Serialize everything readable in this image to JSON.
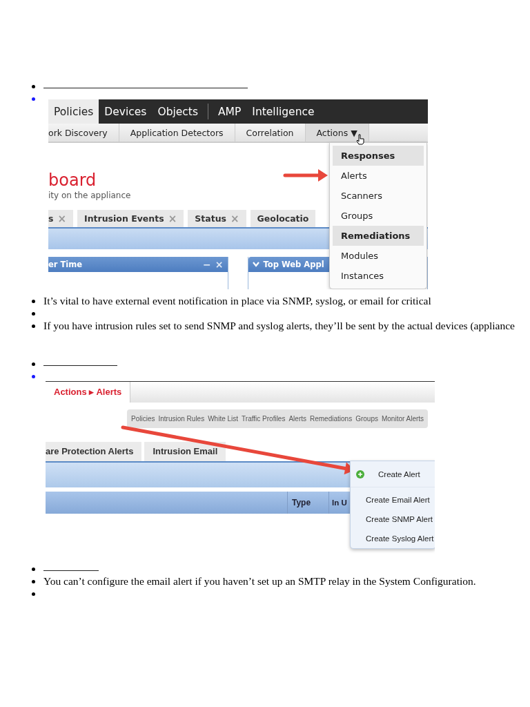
{
  "sections": [
    {
      "items": [
        {
          "kind": "long_rule"
        },
        {
          "kind": "nav_screenshot"
        },
        {
          "kind": "text",
          "text": "It’s vital to have external event notification in place via SNMP, syslog, or email for critical"
        },
        {
          "kind": "empty"
        },
        {
          "kind": "text",
          "text": "If you have intrusion rules set to send SNMP and syslog alerts, they’ll be sent by the actual devices (appliance"
        }
      ]
    },
    {
      "items": [
        {
          "kind": "medium_rule"
        },
        {
          "kind": "alerts_screenshot"
        },
        {
          "kind": "short_rule"
        },
        {
          "kind": "text",
          "text": "You can’t configure the email alert if you haven’t set up an SMTP relay in the System Configuration."
        },
        {
          "kind": "empty"
        }
      ]
    }
  ],
  "nav_screenshot": {
    "top_menu": [
      {
        "label": "Policies",
        "selected": true,
        "separator_before": false
      },
      {
        "label": "Devices",
        "selected": false,
        "separator_before": false
      },
      {
        "label": "Objects",
        "selected": false,
        "separator_before": false
      },
      {
        "label": "AMP",
        "selected": false,
        "separator_before": true
      },
      {
        "label": "Intelligence",
        "selected": false,
        "separator_before": false
      }
    ],
    "sub_menu": [
      {
        "label": "ork Discovery",
        "selected": false
      },
      {
        "label": "Application Detectors",
        "selected": false
      },
      {
        "label": "Correlation",
        "selected": false
      },
      {
        "label": "Actions ▼",
        "selected": true
      }
    ],
    "page_title": "board",
    "page_subtitle": "ity on the appliance",
    "tabs": [
      {
        "label": "s",
        "close": "×"
      },
      {
        "label": "Intrusion Events",
        "close": "×"
      },
      {
        "label": "Status",
        "close": "×"
      },
      {
        "label": "Geolocatio"
      }
    ],
    "widgets": [
      {
        "title": "er Time",
        "minimize": "−",
        "close": "×"
      },
      {
        "title": "Top Web Appl",
        "collapsible": true
      }
    ],
    "menu": [
      {
        "label": "Responses",
        "kind": "header"
      },
      {
        "label": "Alerts",
        "kind": "item"
      },
      {
        "label": "Scanners",
        "kind": "item"
      },
      {
        "label": "Groups",
        "kind": "item"
      },
      {
        "label": "Remediations",
        "kind": "header"
      },
      {
        "label": "Modules",
        "kind": "item"
      },
      {
        "label": "Instances",
        "kind": "item"
      }
    ]
  },
  "alerts_screenshot": {
    "breadcrumb": "Actions ▸ Alerts",
    "sub_menu": [
      "Policies",
      "Intrusion Rules",
      "White List",
      "Traffic Profiles",
      "Alerts",
      "Remediations",
      "Groups",
      "Monitor Alerts"
    ],
    "tabs": [
      "are Protection Alerts",
      "Intrusion Email"
    ],
    "columns": [
      "Type",
      "In U"
    ],
    "menu": [
      {
        "label": "Create Alert",
        "kind": "header"
      },
      {
        "label": "Create Email Alert",
        "kind": "item"
      },
      {
        "label": "Create SNMP Alert",
        "kind": "item"
      },
      {
        "label": "Create Syslog Alert",
        "kind": "item"
      }
    ]
  }
}
